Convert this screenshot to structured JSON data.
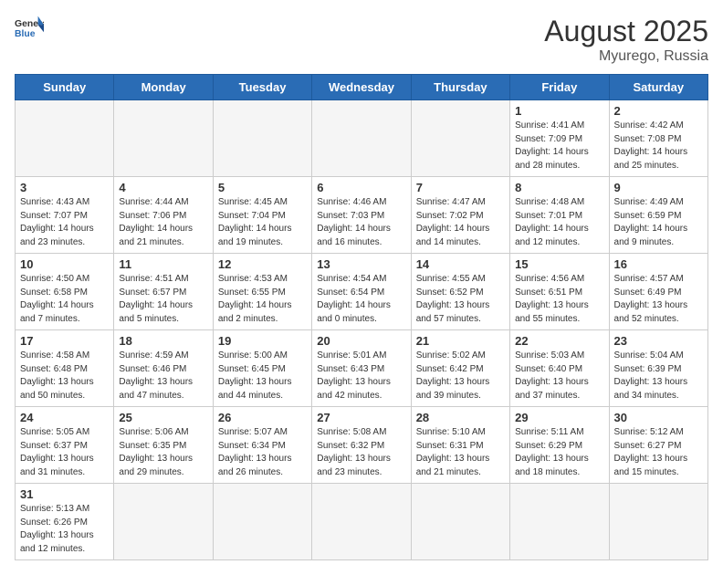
{
  "header": {
    "logo_general": "General",
    "logo_blue": "Blue",
    "month_title": "August 2025",
    "location": "Myurego, Russia"
  },
  "days_of_week": [
    "Sunday",
    "Monday",
    "Tuesday",
    "Wednesday",
    "Thursday",
    "Friday",
    "Saturday"
  ],
  "weeks": [
    [
      {
        "day": "",
        "info": ""
      },
      {
        "day": "",
        "info": ""
      },
      {
        "day": "",
        "info": ""
      },
      {
        "day": "",
        "info": ""
      },
      {
        "day": "",
        "info": ""
      },
      {
        "day": "1",
        "info": "Sunrise: 4:41 AM\nSunset: 7:09 PM\nDaylight: 14 hours\nand 28 minutes."
      },
      {
        "day": "2",
        "info": "Sunrise: 4:42 AM\nSunset: 7:08 PM\nDaylight: 14 hours\nand 25 minutes."
      }
    ],
    [
      {
        "day": "3",
        "info": "Sunrise: 4:43 AM\nSunset: 7:07 PM\nDaylight: 14 hours\nand 23 minutes."
      },
      {
        "day": "4",
        "info": "Sunrise: 4:44 AM\nSunset: 7:06 PM\nDaylight: 14 hours\nand 21 minutes."
      },
      {
        "day": "5",
        "info": "Sunrise: 4:45 AM\nSunset: 7:04 PM\nDaylight: 14 hours\nand 19 minutes."
      },
      {
        "day": "6",
        "info": "Sunrise: 4:46 AM\nSunset: 7:03 PM\nDaylight: 14 hours\nand 16 minutes."
      },
      {
        "day": "7",
        "info": "Sunrise: 4:47 AM\nSunset: 7:02 PM\nDaylight: 14 hours\nand 14 minutes."
      },
      {
        "day": "8",
        "info": "Sunrise: 4:48 AM\nSunset: 7:01 PM\nDaylight: 14 hours\nand 12 minutes."
      },
      {
        "day": "9",
        "info": "Sunrise: 4:49 AM\nSunset: 6:59 PM\nDaylight: 14 hours\nand 9 minutes."
      }
    ],
    [
      {
        "day": "10",
        "info": "Sunrise: 4:50 AM\nSunset: 6:58 PM\nDaylight: 14 hours\nand 7 minutes."
      },
      {
        "day": "11",
        "info": "Sunrise: 4:51 AM\nSunset: 6:57 PM\nDaylight: 14 hours\nand 5 minutes."
      },
      {
        "day": "12",
        "info": "Sunrise: 4:53 AM\nSunset: 6:55 PM\nDaylight: 14 hours\nand 2 minutes."
      },
      {
        "day": "13",
        "info": "Sunrise: 4:54 AM\nSunset: 6:54 PM\nDaylight: 14 hours\nand 0 minutes."
      },
      {
        "day": "14",
        "info": "Sunrise: 4:55 AM\nSunset: 6:52 PM\nDaylight: 13 hours\nand 57 minutes."
      },
      {
        "day": "15",
        "info": "Sunrise: 4:56 AM\nSunset: 6:51 PM\nDaylight: 13 hours\nand 55 minutes."
      },
      {
        "day": "16",
        "info": "Sunrise: 4:57 AM\nSunset: 6:49 PM\nDaylight: 13 hours\nand 52 minutes."
      }
    ],
    [
      {
        "day": "17",
        "info": "Sunrise: 4:58 AM\nSunset: 6:48 PM\nDaylight: 13 hours\nand 50 minutes."
      },
      {
        "day": "18",
        "info": "Sunrise: 4:59 AM\nSunset: 6:46 PM\nDaylight: 13 hours\nand 47 minutes."
      },
      {
        "day": "19",
        "info": "Sunrise: 5:00 AM\nSunset: 6:45 PM\nDaylight: 13 hours\nand 44 minutes."
      },
      {
        "day": "20",
        "info": "Sunrise: 5:01 AM\nSunset: 6:43 PM\nDaylight: 13 hours\nand 42 minutes."
      },
      {
        "day": "21",
        "info": "Sunrise: 5:02 AM\nSunset: 6:42 PM\nDaylight: 13 hours\nand 39 minutes."
      },
      {
        "day": "22",
        "info": "Sunrise: 5:03 AM\nSunset: 6:40 PM\nDaylight: 13 hours\nand 37 minutes."
      },
      {
        "day": "23",
        "info": "Sunrise: 5:04 AM\nSunset: 6:39 PM\nDaylight: 13 hours\nand 34 minutes."
      }
    ],
    [
      {
        "day": "24",
        "info": "Sunrise: 5:05 AM\nSunset: 6:37 PM\nDaylight: 13 hours\nand 31 minutes."
      },
      {
        "day": "25",
        "info": "Sunrise: 5:06 AM\nSunset: 6:35 PM\nDaylight: 13 hours\nand 29 minutes."
      },
      {
        "day": "26",
        "info": "Sunrise: 5:07 AM\nSunset: 6:34 PM\nDaylight: 13 hours\nand 26 minutes."
      },
      {
        "day": "27",
        "info": "Sunrise: 5:08 AM\nSunset: 6:32 PM\nDaylight: 13 hours\nand 23 minutes."
      },
      {
        "day": "28",
        "info": "Sunrise: 5:10 AM\nSunset: 6:31 PM\nDaylight: 13 hours\nand 21 minutes."
      },
      {
        "day": "29",
        "info": "Sunrise: 5:11 AM\nSunset: 6:29 PM\nDaylight: 13 hours\nand 18 minutes."
      },
      {
        "day": "30",
        "info": "Sunrise: 5:12 AM\nSunset: 6:27 PM\nDaylight: 13 hours\nand 15 minutes."
      }
    ],
    [
      {
        "day": "31",
        "info": "Sunrise: 5:13 AM\nSunset: 6:26 PM\nDaylight: 13 hours\nand 12 minutes."
      },
      {
        "day": "",
        "info": ""
      },
      {
        "day": "",
        "info": ""
      },
      {
        "day": "",
        "info": ""
      },
      {
        "day": "",
        "info": ""
      },
      {
        "day": "",
        "info": ""
      },
      {
        "day": "",
        "info": ""
      }
    ]
  ]
}
